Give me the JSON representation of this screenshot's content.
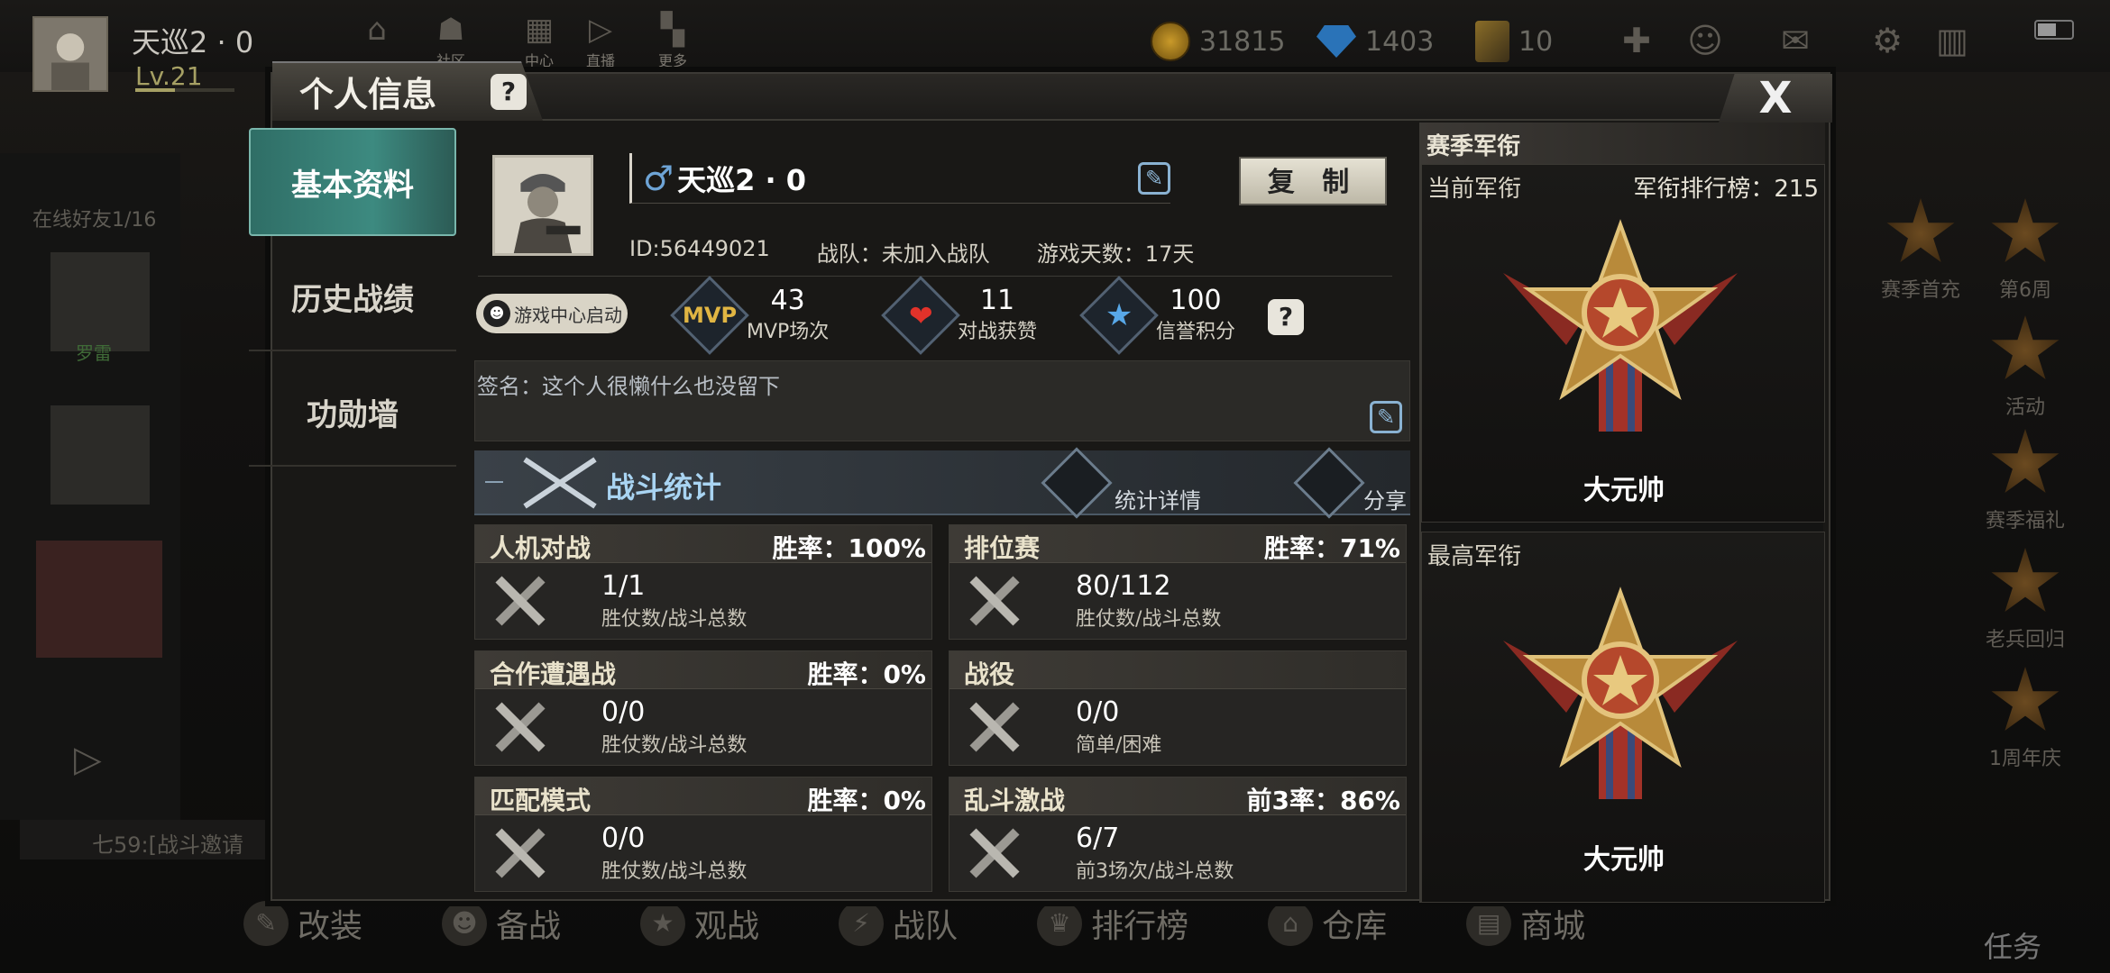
{
  "topbar": {
    "player_name": "天巡2 · 0",
    "level": "Lv.21",
    "nav_labels": [
      "社区",
      "",
      "中心",
      "直播",
      "更多"
    ],
    "gold": "31815",
    "diamonds": "1403",
    "tickets": "10"
  },
  "background": {
    "online_friends": "在线好友1/16",
    "friend_name": "罗雷",
    "chat_preview": "七59:[战斗邀请",
    "right_items": [
      "赛季首充",
      "第6周",
      "活动",
      "赛季福礼",
      "老兵回归",
      "1周年庆"
    ],
    "task_label": "任务",
    "bottom_nav": [
      "改装",
      "备战",
      "观战",
      "战队",
      "排行榜",
      "仓库",
      "商城"
    ]
  },
  "dialog": {
    "title": "个人信息",
    "help": "?",
    "close": "X",
    "tabs": [
      "基本资料",
      "历史战绩",
      "功勋墙"
    ],
    "profile": {
      "gender_symbol": "♂",
      "name": "天巡2 · 0",
      "copy_label": "复 制",
      "id": "ID:56449021",
      "team": "战队：未加入战队",
      "days": "游戏天数：17天",
      "game_center": "游戏中心启动"
    },
    "stats": [
      {
        "icon": "mvp-icon",
        "num": "43",
        "label": "MVP场次",
        "badge": "MVP"
      },
      {
        "icon": "heart-icon",
        "num": "11",
        "label": "对战获赞",
        "badge": "❤"
      },
      {
        "icon": "star-icon",
        "num": "100",
        "label": "信誉积分",
        "badge": "★"
      }
    ],
    "signature": "签名：这个人很懒什么也没留下",
    "battle": {
      "title": "战斗统计",
      "details": "统计详情",
      "share": "分享"
    },
    "cards": [
      {
        "title": "人机对战",
        "rate": "胜率：100%",
        "value": "1/1",
        "sub": "胜仗数/战斗总数"
      },
      {
        "title": "排位赛",
        "rate": "胜率：71%",
        "value": "80/112",
        "sub": "胜仗数/战斗总数"
      },
      {
        "title": "合作遭遇战",
        "rate": "胜率：0%",
        "value": "0/0",
        "sub": "胜仗数/战斗总数"
      },
      {
        "title": "战役",
        "rate": "",
        "value": "0/0",
        "sub": "简单/困难"
      },
      {
        "title": "匹配模式",
        "rate": "胜率：0%",
        "value": "0/0",
        "sub": "胜仗数/战斗总数"
      },
      {
        "title": "乱斗激战",
        "rate": "前3率：86%",
        "value": "6/7",
        "sub": "前3场次/战斗总数"
      }
    ],
    "rank": {
      "section_title": "赛季军衔",
      "current_label": "当前军衔",
      "board": "军衔排行榜：215",
      "current_name": "大元帅",
      "highest_label": "最高军衔",
      "highest_name": "大元帅"
    }
  },
  "colors": {
    "accent_teal": "#3d8a80",
    "gold": "#c99a2a",
    "blue_text": "#a9d4f2"
  }
}
